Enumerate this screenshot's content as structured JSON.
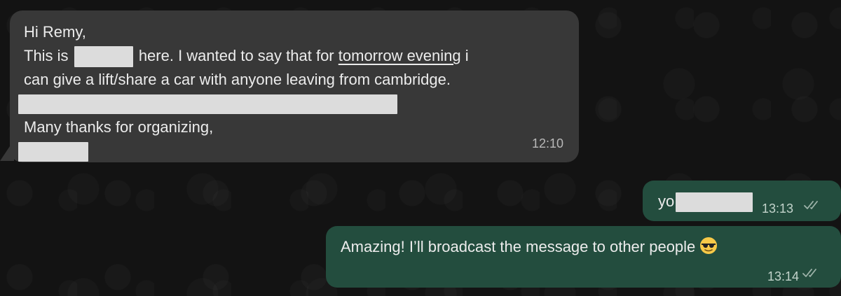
{
  "messages": {
    "incoming": {
      "greeting": "Hi Remy,",
      "line2_start": "This is",
      "line2_mid": "here. I wanted to say that for",
      "line2_link": "tomorrow evening",
      "line2_end": "i",
      "line3": "can give a lift/share a car with anyone leaving from cambridge.",
      "line5": "Many thanks for organizing,",
      "time": "12:10"
    },
    "outgoing_1": {
      "text": "yo",
      "time": "13:13",
      "status_icon": "double-check-read"
    },
    "outgoing_2": {
      "text": "Amazing! I’ll broadcast the message to other people",
      "emoji": "smiling-face-with-sunglasses",
      "time": "13:14",
      "status_icon": "double-check-read"
    }
  },
  "colors": {
    "background": "#131313",
    "incoming_bubble": "#383838",
    "outgoing_bubble": "#234d3e",
    "redaction": "#dcdcdc"
  }
}
